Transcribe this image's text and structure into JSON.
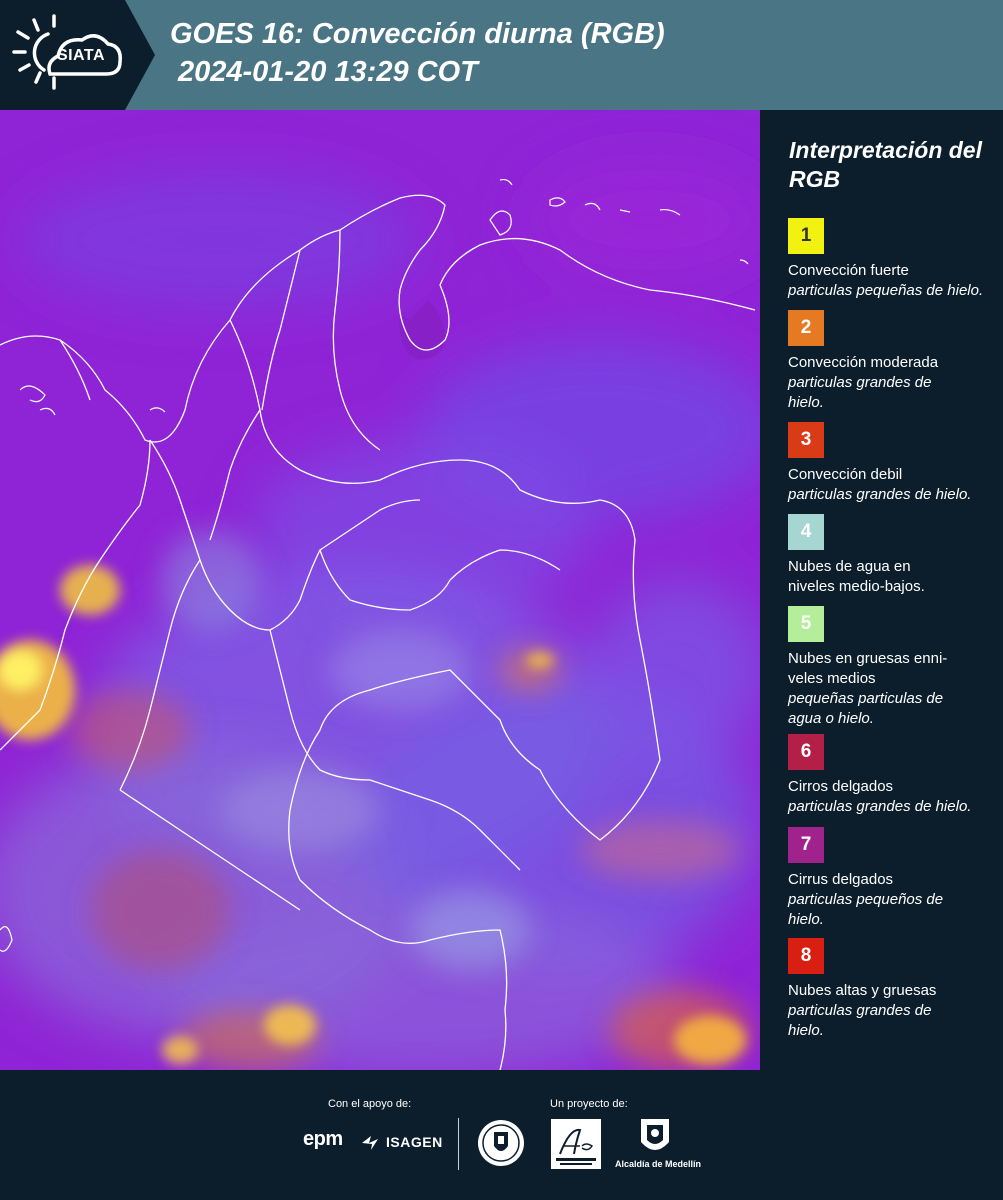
{
  "header": {
    "logo_text": "SIATA",
    "title": "GOES 16: Convección diurna (RGB)",
    "subtitle": "2024-01-20 13:29 COT"
  },
  "legend": {
    "title": "Interpretación del RGB",
    "items": [
      {
        "number": "1",
        "label": "Convección fuerte",
        "sub": "particulas pequeñas de hielo.",
        "color": "#f2f211",
        "text_color": "#333333"
      },
      {
        "number": "2",
        "label": "Convección moderada",
        "sub": "particulas grandes de hielo.",
        "color": "#e57a22",
        "text_color": "#ffffff"
      },
      {
        "number": "3",
        "label": "Convección debil",
        "sub": "particulas grandes de hielo.",
        "color": "#d83b16",
        "text_color": "#ffffff"
      },
      {
        "number": "4",
        "label": "Nubes de agua en niveles medio-bajos.",
        "sub": "",
        "color": "#a6d6d1",
        "text_color": "#ffffff"
      },
      {
        "number": "5",
        "label": "Nubes en gruesas enni-veles medios",
        "sub": "pequeñas particulas de agua o hielo.",
        "color": "#b4ee9a",
        "text_color": "#ffffff"
      },
      {
        "number": "6",
        "label": "Cirros delgados",
        "sub": "particulas grandes de hielo.",
        "color": "#b41f47",
        "text_color": "#ffffff"
      },
      {
        "number": "7",
        "label": "Cirrus delgados",
        "sub": "particulas pequeños de hielo.",
        "color": "#a0228c",
        "text_color": "#ffffff"
      },
      {
        "number": "8",
        "label": "Nubes altas y gruesas",
        "sub": "particulas grandes de hielo.",
        "color": "#d81f12",
        "text_color": "#ffffff"
      }
    ]
  },
  "footer": {
    "support_label": "Con el apoyo de:",
    "project_label": "Un proyecto de:",
    "sponsor_1": "epm",
    "sponsor_2": "ISAGEN",
    "partner_1": "Área Metropolitana Valle de Aburrá",
    "partner_2": "Alcaldía de Medellín"
  },
  "colors": {
    "header_bg": "#4a7584",
    "panel_bg": "#0c1e2c",
    "map_base": "#8f24d6"
  }
}
